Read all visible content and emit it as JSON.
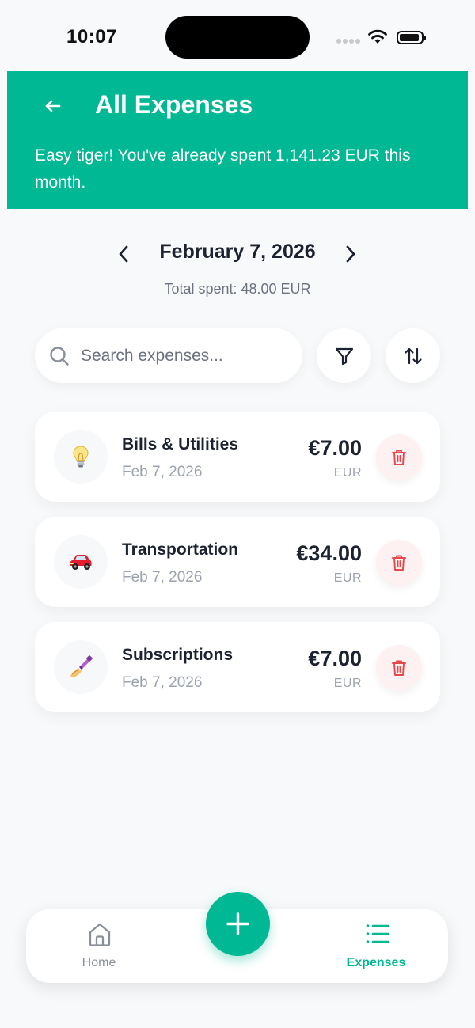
{
  "status_bar": {
    "time": "10:07"
  },
  "header": {
    "title": "All Expenses",
    "message": "Easy tiger! You've already spent 1,141.23 EUR this month."
  },
  "date_nav": {
    "date": "February 7, 2026",
    "total": "Total spent: 48.00 EUR"
  },
  "search": {
    "placeholder": "Search expenses..."
  },
  "expenses": [
    {
      "icon": "lightbulb-icon",
      "category": "Bills & Utilities",
      "date": "Feb 7, 2026",
      "amount": "€7.00",
      "currency": "EUR"
    },
    {
      "icon": "car-icon",
      "category": "Transportation",
      "date": "Feb 7, 2026",
      "amount": "€34.00",
      "currency": "EUR"
    },
    {
      "icon": "nail-polish-icon",
      "category": "Subscriptions",
      "date": "Feb 7, 2026",
      "amount": "€7.00",
      "currency": "EUR"
    }
  ],
  "tabbar": {
    "home_label": "Home",
    "expenses_label": "Expenses",
    "active_tab": "Expenses"
  },
  "colors": {
    "accent": "#00b894",
    "danger": "#e5484d",
    "background": "#f7f9fa",
    "text": "#1c2230"
  }
}
